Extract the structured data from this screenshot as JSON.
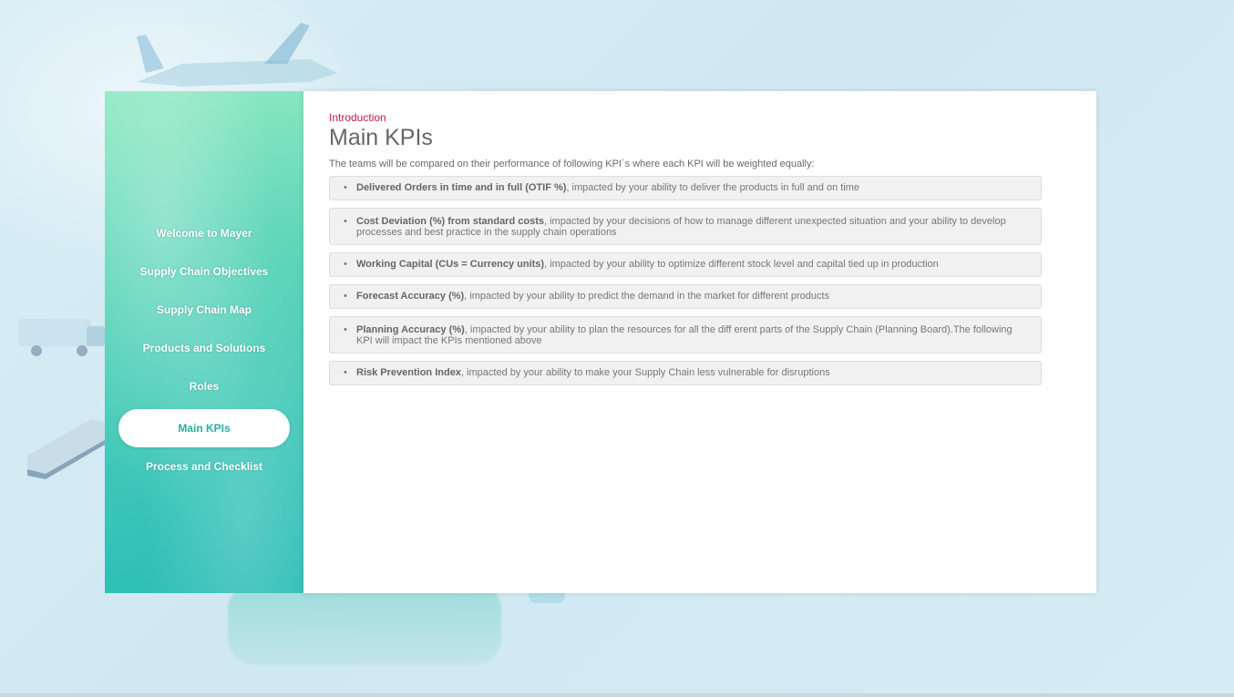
{
  "background": {
    "colors": {
      "base": "#d6ecf4",
      "sidebar_top": "#8ee9c2",
      "sidebar_bottom": "#2bbdb7"
    }
  },
  "sidebar": {
    "items": [
      {
        "label": "Welcome to Mayer",
        "active": false
      },
      {
        "label": "Supply Chain Objectives",
        "active": false
      },
      {
        "label": "Supply Chain Map",
        "active": false
      },
      {
        "label": "Products and Solutions",
        "active": false
      },
      {
        "label": "Roles",
        "active": false
      },
      {
        "label": "Main KPIs",
        "active": true
      },
      {
        "label": "Process and Checklist",
        "active": false
      }
    ]
  },
  "main": {
    "breadcrumb": "Introduction",
    "title": "Main KPIs",
    "intro": "The teams will be compared on their performance of following KPI´s where each KPI will be weighted equally:",
    "accent_color": "#c8174e",
    "kpis": [
      {
        "name": "Delivered Orders in time and in full (OTIF %)",
        "description": ", impacted by your ability to deliver the products in full and on time"
      },
      {
        "name": "Cost Deviation (%) from standard costs",
        "description": ", impacted by your decisions of how to manage different unexpected situation and your ability to develop processes and best practice in the supply chain operations"
      },
      {
        "name": "Working Capital (CUs = Currency units)",
        "description": ", impacted by your ability to optimize different stock level and capital tied up in production"
      },
      {
        "name": "Forecast Accuracy (%)",
        "description": ", impacted by your ability to predict the demand in the market for different products"
      },
      {
        "name": "Planning Accuracy (%)",
        "description": ", impacted by your ability to plan the resources for all the diff erent parts of the Supply Chain (Planning Board).The following KPI will impact the KPIs mentioned above"
      },
      {
        "name": "Risk Prevention Index",
        "description": ", impacted by your ability to make your Supply Chain less vulnerable for disruptions"
      }
    ]
  }
}
